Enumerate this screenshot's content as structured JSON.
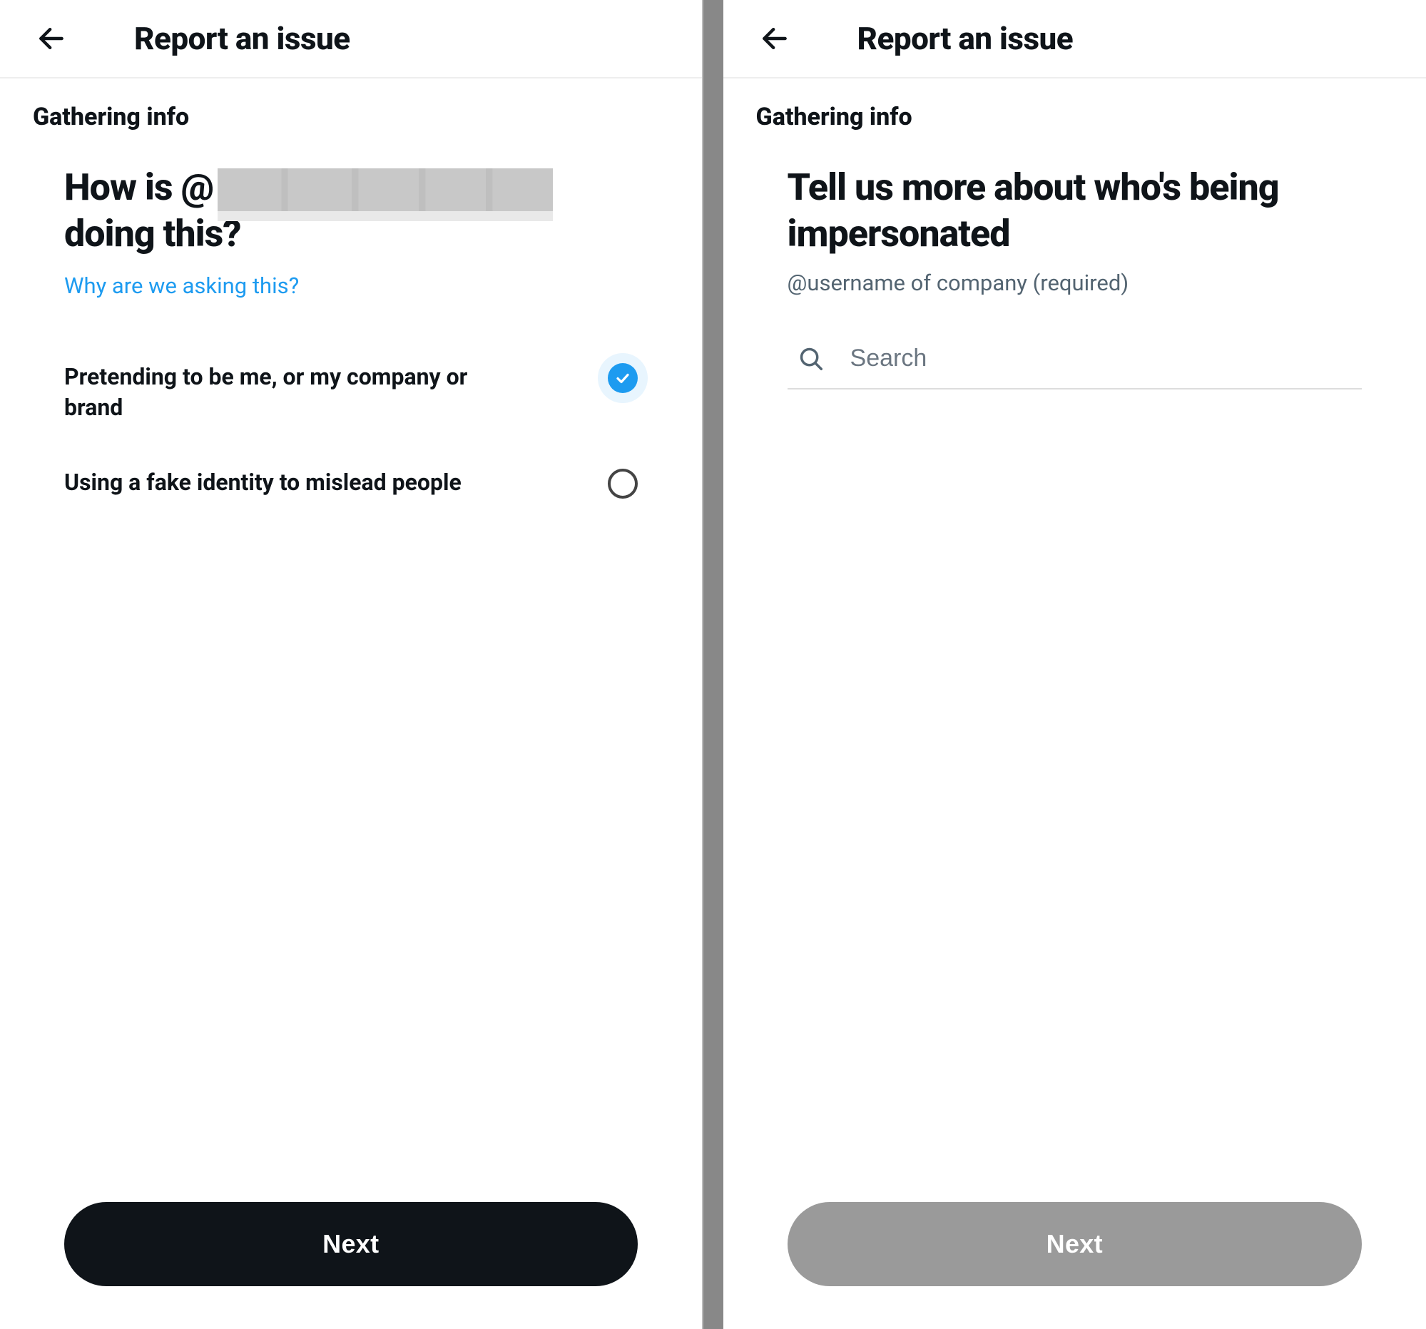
{
  "left": {
    "header": {
      "title": "Report an issue"
    },
    "section_label": "Gathering info",
    "question_prefix": "How is @",
    "question_suffix": "doing this?",
    "why_link": "Why are we asking this?",
    "options": [
      {
        "label": "Pretending to be me, or my company or brand",
        "selected": true
      },
      {
        "label": "Using a fake identity to mislead people",
        "selected": false
      }
    ],
    "next_label": "Next",
    "next_enabled": true
  },
  "right": {
    "header": {
      "title": "Report an issue"
    },
    "section_label": "Gathering info",
    "heading": "Tell us more about who's being impersonated",
    "subtitle": "@username of company (required)",
    "search_placeholder": "Search",
    "next_label": "Next",
    "next_enabled": false
  }
}
